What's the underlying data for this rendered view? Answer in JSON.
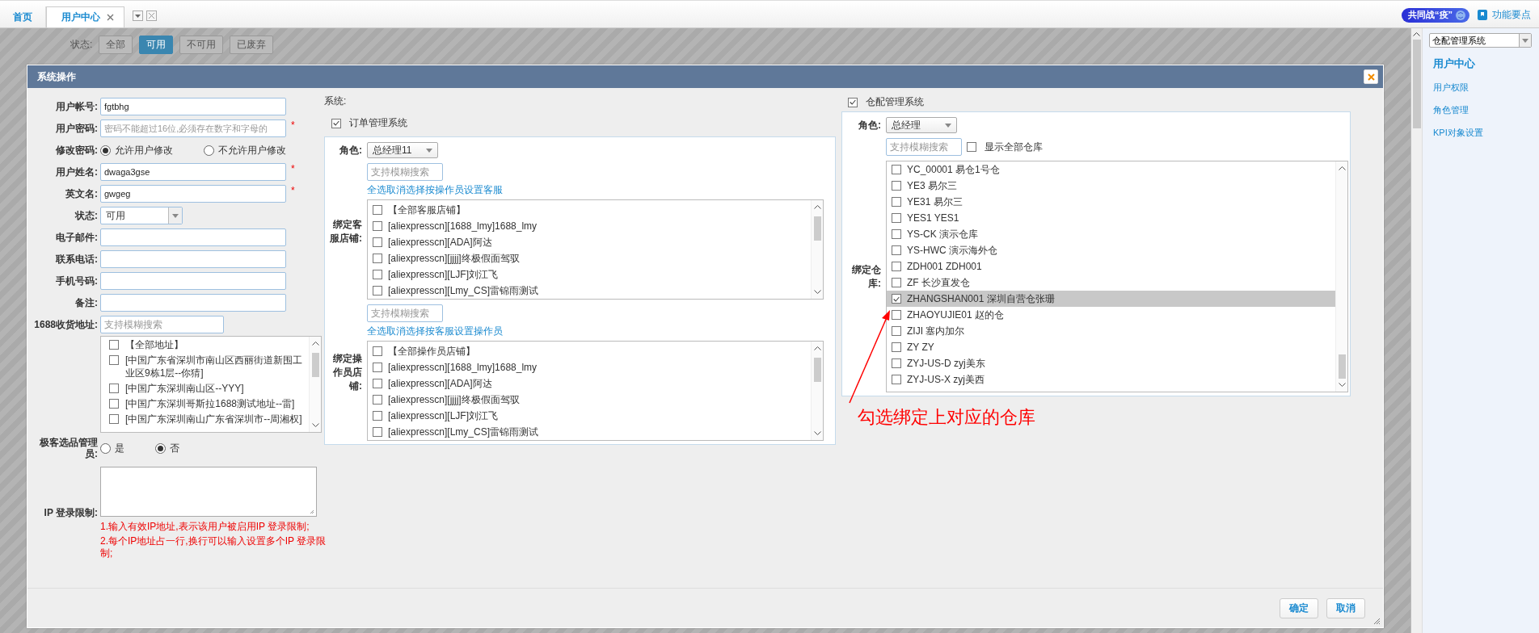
{
  "tabs": [
    {
      "label": "首页",
      "selected": false,
      "closable": false
    },
    {
      "label": "用户中心",
      "selected": true,
      "closable": true
    }
  ],
  "header_right": {
    "badge": "共同战“疫”",
    "help_link": "功能要点"
  },
  "background_filter": {
    "label": "状态:",
    "options": [
      {
        "label": "全部",
        "selected": false
      },
      {
        "label": "可用",
        "selected": true
      },
      {
        "label": "不可用",
        "selected": false
      },
      {
        "label": "已废弃",
        "selected": false
      }
    ]
  },
  "sidebar": {
    "system_select": "仓配管理系统",
    "items": [
      {
        "label": "用户中心",
        "selected": true
      },
      {
        "label": "用户权限",
        "selected": false
      },
      {
        "label": "角色管理",
        "selected": false
      },
      {
        "label": "KPI对象设置",
        "selected": false
      }
    ]
  },
  "dialog": {
    "title": "系统操作",
    "fields": [
      {
        "kind": "text",
        "label": "用户帐号:",
        "value": "fgtbhg"
      },
      {
        "kind": "text",
        "label": "用户密码:",
        "placeholder": "密码不能超过16位,必须存在数字和字母的",
        "required_mark": "*"
      },
      {
        "kind": "radio",
        "label": "修改密码:",
        "options": [
          {
            "label": "允许用户修改",
            "selected": true
          },
          {
            "label": "不允许用户修改",
            "selected": false
          }
        ]
      },
      {
        "kind": "text",
        "label": "用户姓名:",
        "value": "dwaga3gse",
        "required_mark": "*"
      },
      {
        "kind": "text",
        "label": "英文名:",
        "value": "gwgeg",
        "required_mark": "*"
      },
      {
        "kind": "select",
        "label": "状态:",
        "value": "可用"
      },
      {
        "kind": "text",
        "label": "电子邮件:"
      },
      {
        "kind": "text",
        "label": "联系电话:"
      },
      {
        "kind": "text",
        "label": "手机号码:"
      },
      {
        "kind": "text",
        "label": "备注:"
      },
      {
        "kind": "search_list",
        "label": "1688收货地址:",
        "placeholder": "支持模糊搜索",
        "items": [
          {
            "label": "【全部地址】",
            "checked": false
          },
          {
            "label": "[中国广东省深圳市南山区西丽街道新围工业区9栋1层--你猜]",
            "checked": false
          },
          {
            "label": "[中国广东深圳南山区--YYY]",
            "checked": false
          },
          {
            "label": "[中国广东深圳哥斯拉1688测试地址--雷]",
            "checked": false
          },
          {
            "label": "[中国广东深圳南山广东省深圳市--周湘权]",
            "checked": false
          }
        ]
      },
      {
        "kind": "radio",
        "label": "极客选品管理员:",
        "options": [
          {
            "label": "是",
            "selected": false
          },
          {
            "label": "否",
            "selected": true
          }
        ]
      },
      {
        "kind": "textarea",
        "label": "IP 登录限制:",
        "notes": [
          "1.输入有效IP地址,表示该用户被启用IP 登录限制;",
          "2.每个IP地址占一行,换行可以输入设置多个IP 登录限制;"
        ]
      }
    ],
    "systems_label": "系统:",
    "order_system": {
      "label": "订单管理系统",
      "checked": true,
      "role_label": "角色:",
      "role": "总经理11",
      "lists": [
        {
          "label": "绑定客服店铺:",
          "search_placeholder": "支持模糊搜索",
          "link": "全选取消选择按操作员设置客服",
          "items": [
            {
              "label": "【全部客服店铺】",
              "checked": false
            },
            {
              "label": "[aliexpresscn][1688_lmy]1688_lmy",
              "checked": false
            },
            {
              "label": "[aliexpresscn][ADA]阿达",
              "checked": false
            },
            {
              "label": "[aliexpresscn][jjjj]终极假面驾驭",
              "checked": false
            },
            {
              "label": "[aliexpresscn][LJF]刘江飞",
              "checked": false
            },
            {
              "label": "[aliexpresscn][Lmy_CS]雷锦雨测试",
              "checked": false
            }
          ]
        },
        {
          "label": "绑定操作员店铺:",
          "search_placeholder": "支持模糊搜索",
          "link": "全选取消选择按客服设置操作员",
          "items": [
            {
              "label": "【全部操作员店铺】",
              "checked": false
            },
            {
              "label": "[aliexpresscn][1688_lmy]1688_lmy",
              "checked": false
            },
            {
              "label": "[aliexpresscn][ADA]阿达",
              "checked": false
            },
            {
              "label": "[aliexpresscn][jjjj]终极假面驾驭",
              "checked": false
            },
            {
              "label": "[aliexpresscn][LJF]刘江飞",
              "checked": false
            },
            {
              "label": "[aliexpresscn][Lmy_CS]雷锦雨测试",
              "checked": false
            }
          ]
        }
      ]
    },
    "warehouse_system": {
      "label": "仓配管理系统",
      "checked": true,
      "role_label": "角色:",
      "role": "总经理",
      "search_placeholder": "支持模糊搜索",
      "show_all": {
        "label": "显示全部仓库",
        "checked": false
      },
      "list_label": "绑定仓库:",
      "items": [
        {
          "label": "YC_00001 易仓1号仓",
          "checked": false,
          "selected": false
        },
        {
          "label": "YE3 易尔三",
          "checked": false,
          "selected": false
        },
        {
          "label": "YE31 易尔三",
          "checked": false,
          "selected": false
        },
        {
          "label": "YES1 YES1",
          "checked": false,
          "selected": false
        },
        {
          "label": "YS-CK 演示仓库",
          "checked": false,
          "selected": false
        },
        {
          "label": "YS-HWC 演示海外仓",
          "checked": false,
          "selected": false
        },
        {
          "label": "ZDH001 ZDH001",
          "checked": false,
          "selected": false
        },
        {
          "label": "ZF 长沙直发仓",
          "checked": false,
          "selected": false
        },
        {
          "label": "ZHANGSHAN001 深圳自营仓张珊",
          "checked": true,
          "selected": true
        },
        {
          "label": "ZHAOYUJIE01 赵的仓",
          "checked": false,
          "selected": false
        },
        {
          "label": "ZIJI 塞内加尔",
          "checked": false,
          "selected": false
        },
        {
          "label": "ZY ZY",
          "checked": false,
          "selected": false
        },
        {
          "label": "ZYJ-US-D zyj美东",
          "checked": false,
          "selected": false
        },
        {
          "label": "ZYJ-US-X zyj美西",
          "checked": false,
          "selected": false
        }
      ]
    },
    "annotation": "勾选绑定上对应的仓库",
    "buttons": [
      "确定",
      "取消"
    ]
  }
}
